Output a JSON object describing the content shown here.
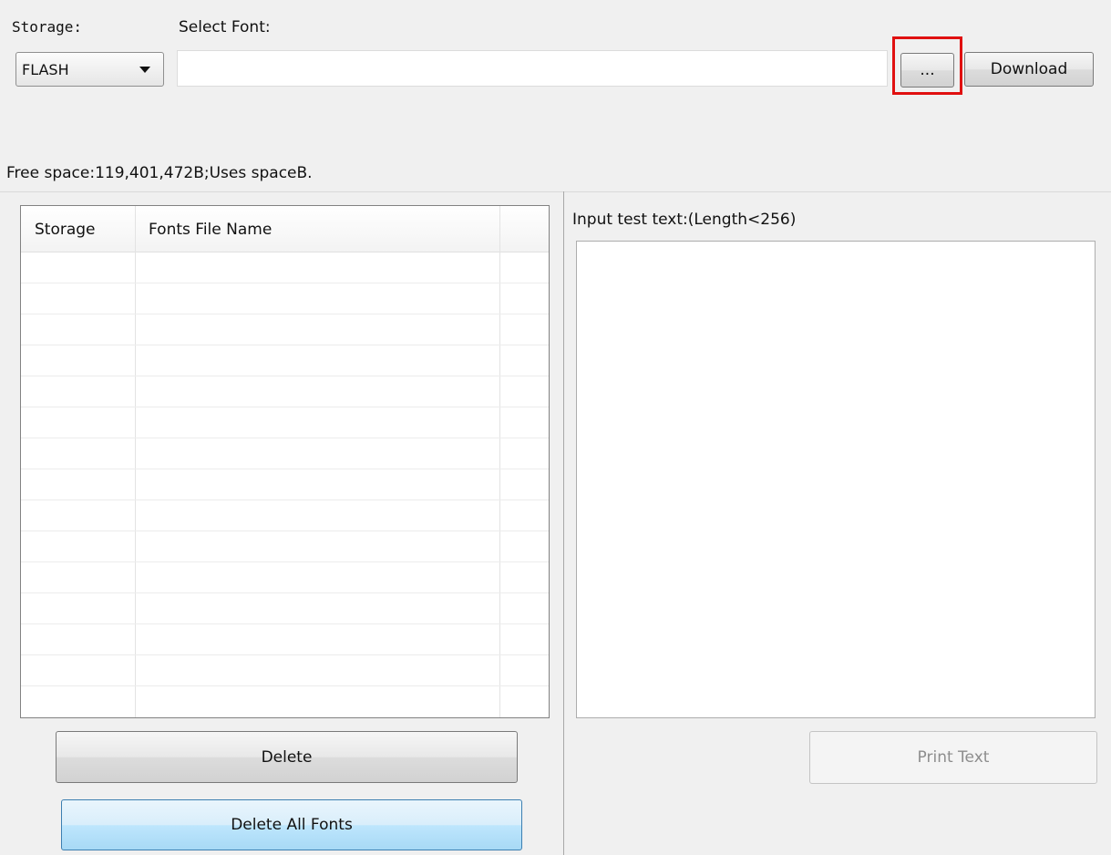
{
  "storage": {
    "label": "Storage:",
    "selected": "FLASH"
  },
  "font_select": {
    "label": "Select Font:",
    "value": "",
    "browse_label": "...",
    "download_label": "Download"
  },
  "free_space_text": "Free space:119,401,472B;Uses spaceB.",
  "fonts_table": {
    "columns": [
      "Storage",
      "Fonts File Name",
      ""
    ],
    "rows": []
  },
  "actions": {
    "delete_label": "Delete",
    "delete_all_label": "Delete All Fonts"
  },
  "test_text": {
    "label": "Input test text:(Length<256)",
    "value": "",
    "print_label": "Print Text"
  },
  "colors": {
    "highlight": "#e01010",
    "focus_accent": "#3c7fb1"
  }
}
